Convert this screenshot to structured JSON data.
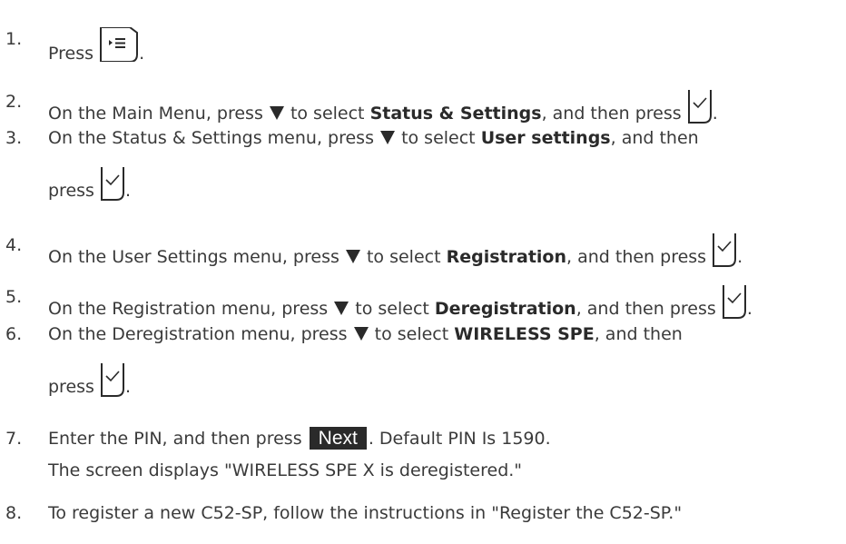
{
  "steps": [
    {
      "num": "1.",
      "pre": "Press",
      "post": "."
    },
    {
      "num": "2.",
      "pre": "On the Main Menu, press",
      "mid": "to select",
      "bold": "Status & Settings",
      "post": ", and then press",
      "end": "."
    },
    {
      "num": "3.",
      "pre": "On the Status & Settings menu, press",
      "mid": "to select",
      "bold": "User settings",
      "post": ", and then",
      "line2": "press",
      "end": "."
    },
    {
      "num": "4.",
      "pre": "On the User Settings menu, press",
      "mid": "to select",
      "bold": "Registration",
      "post": ", and then press",
      "end": "."
    },
    {
      "num": "5.",
      "pre": "On the Registration menu, press",
      "mid": "to select",
      "bold": "Deregistration",
      "post": ", and then press",
      "end": "."
    },
    {
      "num": "6.",
      "pre": "On the Deregistration menu, press",
      "mid": "to select",
      "bold": "WIRELESS SPE",
      "post": ", and then",
      "line2": "press",
      "end": "."
    },
    {
      "num": "7.",
      "pre": "Enter the PIN, and then press",
      "button": "Next",
      "post": ". Default PIN Is 1590.",
      "line2": "The screen displays \"WIRELESS SPE X is deregistered.\""
    },
    {
      "num": "8.",
      "pre": "To register a new C52-SP, follow the instructions in \"Register the C52-SP.\""
    }
  ],
  "icons": {
    "menu": "menu-icon",
    "check": "checkmark-icon",
    "down": "down-arrow-icon"
  }
}
